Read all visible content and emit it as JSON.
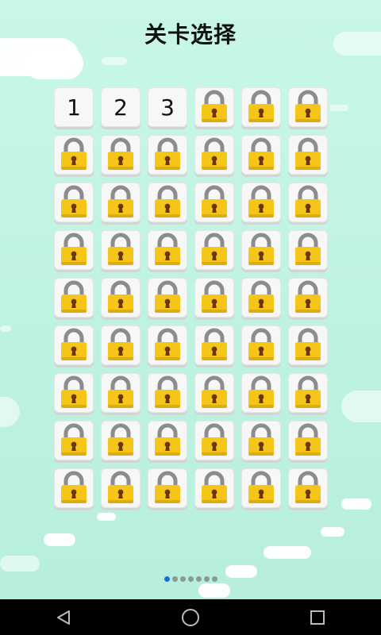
{
  "header": {
    "title": "关卡选择"
  },
  "levels": [
    {
      "number": "1",
      "state": "unlocked"
    },
    {
      "number": "2",
      "state": "unlocked"
    },
    {
      "number": "3",
      "state": "unlocked"
    },
    {
      "state": "locked"
    },
    {
      "state": "locked"
    },
    {
      "state": "locked"
    },
    {
      "state": "locked"
    },
    {
      "state": "locked"
    },
    {
      "state": "locked"
    },
    {
      "state": "locked"
    },
    {
      "state": "locked"
    },
    {
      "state": "locked"
    },
    {
      "state": "locked"
    },
    {
      "state": "locked"
    },
    {
      "state": "locked"
    },
    {
      "state": "locked"
    },
    {
      "state": "locked"
    },
    {
      "state": "locked"
    },
    {
      "state": "locked"
    },
    {
      "state": "locked"
    },
    {
      "state": "locked"
    },
    {
      "state": "locked"
    },
    {
      "state": "locked"
    },
    {
      "state": "locked"
    },
    {
      "state": "locked"
    },
    {
      "state": "locked"
    },
    {
      "state": "locked"
    },
    {
      "state": "locked"
    },
    {
      "state": "locked"
    },
    {
      "state": "locked"
    },
    {
      "state": "locked"
    },
    {
      "state": "locked"
    },
    {
      "state": "locked"
    },
    {
      "state": "locked"
    },
    {
      "state": "locked"
    },
    {
      "state": "locked"
    },
    {
      "state": "locked"
    },
    {
      "state": "locked"
    },
    {
      "state": "locked"
    },
    {
      "state": "locked"
    },
    {
      "state": "locked"
    },
    {
      "state": "locked"
    },
    {
      "state": "locked"
    },
    {
      "state": "locked"
    },
    {
      "state": "locked"
    },
    {
      "state": "locked"
    },
    {
      "state": "locked"
    },
    {
      "state": "locked"
    },
    {
      "state": "locked"
    },
    {
      "state": "locked"
    },
    {
      "state": "locked"
    },
    {
      "state": "locked"
    },
    {
      "state": "locked"
    },
    {
      "state": "locked"
    }
  ],
  "pagination": {
    "total_pages": 7,
    "current_page": 1
  },
  "icons": {
    "locked": "padlock-icon"
  },
  "colors": {
    "background": "#c2f5e4",
    "lock_body": "#f5c518",
    "lock_shackle": "#8c8c8c",
    "page_dot_active": "#1a6fd8",
    "page_dot": "#8a9a95"
  },
  "navbar": [
    {
      "name": "back-button",
      "icon": "back-triangle-icon"
    },
    {
      "name": "home-button",
      "icon": "home-circle-icon"
    },
    {
      "name": "recents-button",
      "icon": "recents-square-icon"
    }
  ]
}
